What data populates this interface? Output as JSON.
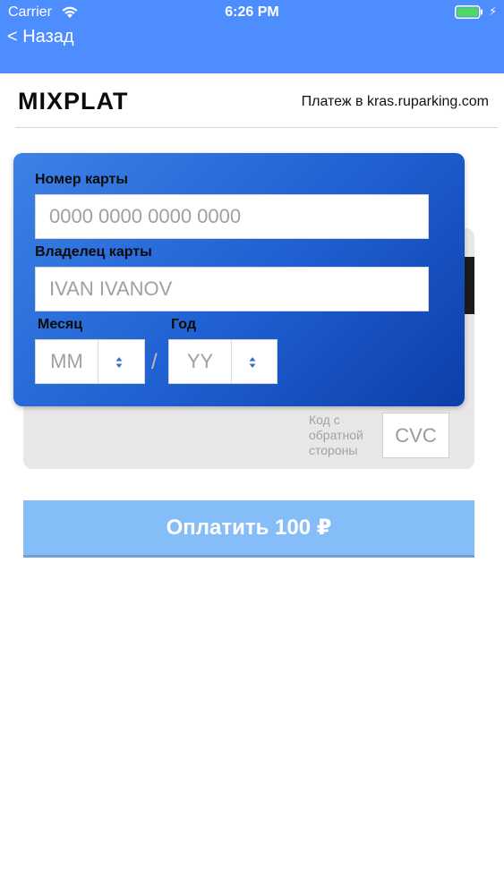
{
  "status_bar": {
    "carrier": "Carrier",
    "time": "6:26 PM",
    "wifi_icon": "wifi-icon",
    "battery_icon": "battery-icon",
    "charging_icon": "bolt-icon"
  },
  "nav": {
    "back_label": "< Назад"
  },
  "header": {
    "brand": "MIXPLAT",
    "payment_info": "Платеж в kras.ruparking.com"
  },
  "card_form": {
    "card_number_label": "Номер карты",
    "card_number_placeholder": "0000 0000 0000 0000",
    "holder_label": "Владелец карты",
    "holder_placeholder": "IVAN IVANOV",
    "month_label": "Месяц",
    "month_placeholder": "MM",
    "year_label": "Год",
    "year_placeholder": "YY",
    "separator": "/",
    "cvc_label_line1": "Код с",
    "cvc_label_line2": "обратной",
    "cvc_label_line3": "стороны",
    "cvc_placeholder": "CVC"
  },
  "pay_button": {
    "label": "Оплатить 100 ₽"
  },
  "colors": {
    "nav_bar": "#4d8dfe",
    "card_front": "#1f5fd1",
    "pay_button": "#85bdf9"
  }
}
